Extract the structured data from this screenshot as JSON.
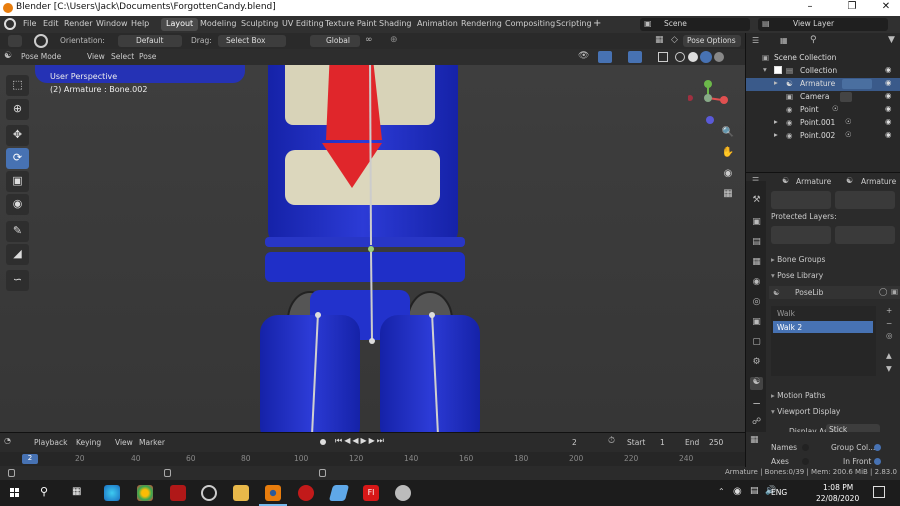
{
  "window": {
    "title": "Blender [C:\\Users\\Jack\\Documents\\ForgottenCandy.blend]",
    "minimize": "–",
    "maximize": "❐",
    "close": "✕"
  },
  "menu": {
    "items": [
      "File",
      "Edit",
      "Render",
      "Window",
      "Help"
    ]
  },
  "workspaces": [
    "Layout",
    "Modeling",
    "Sculpting",
    "UV Editing",
    "Texture Paint",
    "Shading",
    "Animation",
    "Rendering",
    "Compositing",
    "Scripting"
  ],
  "add_workspace": "+",
  "scene": {
    "label": "Scene",
    "view_layer": "View Layer"
  },
  "header": {
    "orientation_label": "Orientation:",
    "orientation_value": "Default",
    "drag_label": "Drag:",
    "drag_value": "Select Box",
    "transform": "Global",
    "pose_options": "Pose Options"
  },
  "viewport_header": {
    "mode": "Pose Mode",
    "menus": [
      "View",
      "Select",
      "Pose"
    ]
  },
  "viewport": {
    "perspective": "User Perspective",
    "object_info": "(2) Armature : Bone.002"
  },
  "outliner": {
    "root": "Scene Collection",
    "collection": "Collection",
    "items": [
      {
        "name": "Armature",
        "selected": true
      },
      {
        "name": "Camera",
        "selected": false
      },
      {
        "name": "Point",
        "selected": false
      },
      {
        "name": "Point.001",
        "selected": false
      },
      {
        "name": "Point.002",
        "selected": false
      }
    ]
  },
  "properties": {
    "object_name": "Armature",
    "data_name": "Armature",
    "protected_layers": "Protected Layers:",
    "panels": {
      "bone_groups": "Bone Groups",
      "pose_library": "Pose Library",
      "motion_paths": "Motion Paths",
      "viewport_display": "Viewport Display"
    },
    "poselib": {
      "name": "PoseLib",
      "poses": [
        "Walk",
        "Walk 2"
      ],
      "selected": "Walk 2"
    },
    "display_as_label": "Display As",
    "display_as_value": "Stick",
    "names_label": "Names",
    "axes_label": "Axes",
    "group_colors_label": "Group Col...",
    "in_front_label": "In Front"
  },
  "timeline": {
    "menus": [
      "Playback",
      "Keying",
      "View",
      "Marker"
    ],
    "current_frame": "2",
    "start_label": "Start",
    "start": "1",
    "end_label": "End",
    "end": "250",
    "ruler": [
      "0",
      "20",
      "40",
      "60",
      "80",
      "100",
      "120",
      "140",
      "160",
      "180",
      "200",
      "220",
      "240"
    ],
    "playhead": "2"
  },
  "status": {
    "text": "Armature | Bones:0/39 | Mem: 200.6 MiB | 2.83.0"
  },
  "taskbar": {
    "time": "1:08 PM",
    "date": "22/08/2020",
    "lang": "ENG"
  },
  "colors": {
    "accent": "#4772b3",
    "selected_row": "#3a5a8a",
    "robot_blue": "#1f2fc8",
    "tie_red": "#e0262b",
    "cream": "#d8d3b8"
  }
}
